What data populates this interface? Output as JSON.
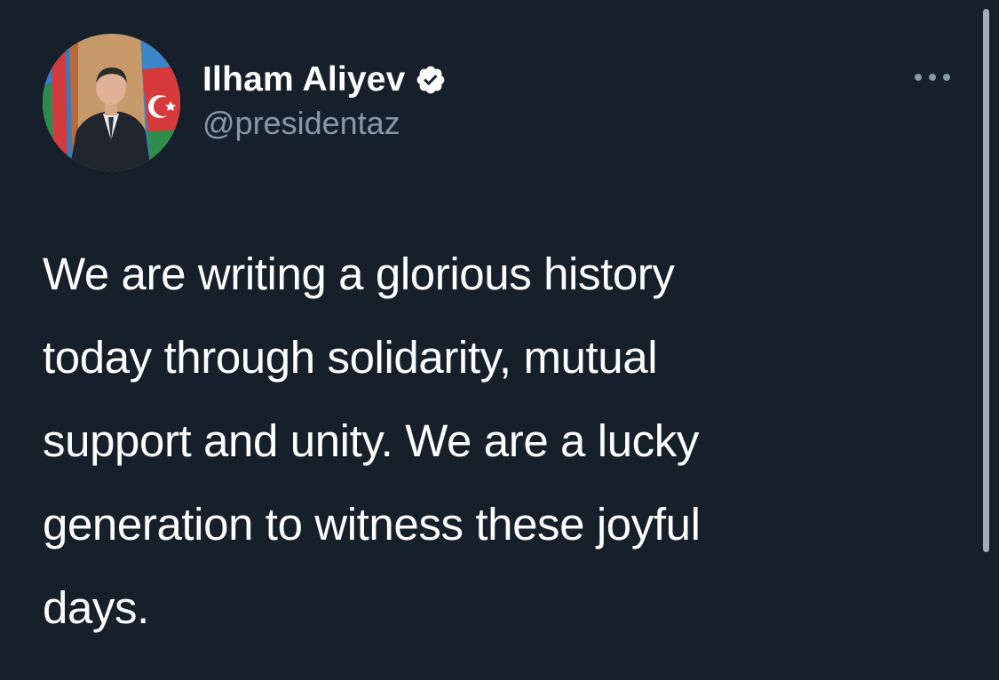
{
  "tweet": {
    "author": {
      "display_name": "Ilham Aliyev",
      "handle": "@presidentaz",
      "verified": true,
      "avatar_icon": "profile-photo"
    },
    "more_icon": "more-horizontal-icon",
    "text": "We are writing a glorious history\ntoday through solidarity, mutual\nsupport and unity. We are a lucky\ngeneration to witness these joyful\ndays."
  },
  "colors": {
    "background": "#15202b",
    "primary_text": "#ffffff",
    "secondary_text": "#8899a6",
    "scrollbar": "#a5adb5"
  }
}
